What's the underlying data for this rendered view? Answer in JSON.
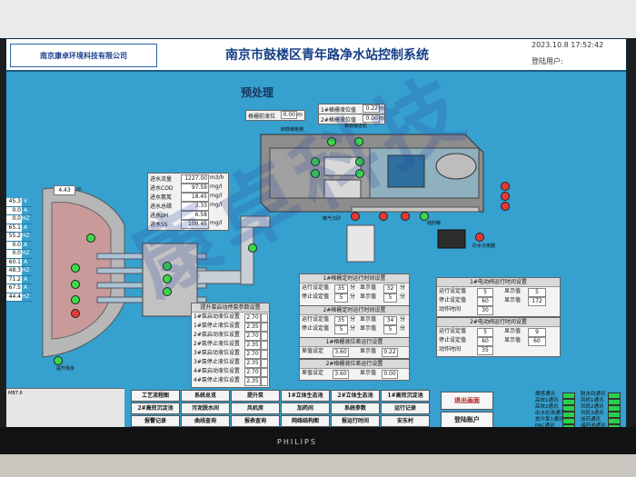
{
  "header": {
    "logo": "南京康卓环境科技有限公司",
    "title": "南京市鼓楼区青年路净水站控制系统",
    "datetime": "2023.10.8    17:52:42",
    "login_label": "登陆用户:"
  },
  "page": {
    "subtitle": "预处理"
  },
  "level_gauges": {
    "grid1_label": "1#格栅液位值",
    "grid1_value": "0.22",
    "grid1_unit": "m",
    "grid2_label": "2#格栅液位值",
    "grid2_value": "0.00",
    "grid2_unit": "m",
    "tank_label": "格栅前液位",
    "tank_value": "0.00",
    "tank_unit": "m"
  },
  "equipment_labels": {
    "screen": "转鼓细格栅",
    "sand": "螺旋输送机",
    "pump_house": "提升泵房",
    "aeration": "曝气沉砂",
    "sand_pump": "砂水分离器",
    "dosing": "储药罐",
    "flow_label": "4.43",
    "flow_unit": "m"
  },
  "influent": {
    "rows": [
      {
        "label": "进水流量",
        "value": "1227.00",
        "unit": "m3/h"
      },
      {
        "label": "进水COD",
        "value": "97.59",
        "unit": "mg/l"
      },
      {
        "label": "进水氨氮",
        "value": "18.45",
        "unit": "mg/l"
      },
      {
        "label": "进水总磷",
        "value": "3.33",
        "unit": "mg/l"
      },
      {
        "label": "进水pH",
        "value": "6.58",
        "unit": ""
      },
      {
        "label": "进水SS",
        "value": "100.45",
        "unit": "mg/l"
      }
    ]
  },
  "left_column": [
    {
      "value": "45.3",
      "unit": "V"
    },
    {
      "value": "0.0",
      "unit": "A"
    },
    {
      "value": "0.0",
      "unit": "HZ"
    },
    {
      "value": "65.1",
      "unit": "A"
    },
    {
      "value": "55.2",
      "unit": "HZ"
    },
    {
      "value": "0.0",
      "unit": "A"
    },
    {
      "value": "0.0",
      "unit": "HZ"
    },
    {
      "value": "60.1",
      "unit": "A"
    },
    {
      "value": "48.3",
      "unit": "HZ"
    },
    {
      "value": "71.2",
      "unit": "A"
    },
    {
      "value": "67.5",
      "unit": "A"
    },
    {
      "value": "44.4",
      "unit": "HZ"
    }
  ],
  "pump_setpoints": {
    "title": "提升泵启动停泵参数设置",
    "rows": [
      {
        "label": "1#泵启动液位设置",
        "value": "2.70"
      },
      {
        "label": "1#泵停止液位设置",
        "value": "2.35"
      },
      {
        "label": "2#泵启动液位设置",
        "value": "2.70"
      },
      {
        "label": "2#泵停止液位设置",
        "value": "2.35"
      },
      {
        "label": "3#泵启动液位设置",
        "value": "2.70"
      },
      {
        "label": "3#泵停止液位设置",
        "value": "2.35"
      },
      {
        "label": "4#泵启动液位设置",
        "value": "2.70"
      },
      {
        "label": "4#泵停止液位设置",
        "value": "2.35"
      }
    ]
  },
  "grid1_timer": {
    "title": "1#格栅定时运行时间设置",
    "rows": [
      {
        "label": "运行设定值",
        "set": "35",
        "u1": "分",
        "show_label": "显示值",
        "show": "32",
        "u2": "分"
      },
      {
        "label": "停止设定值",
        "set": "5",
        "u1": "分",
        "show_label": "显示值",
        "show": "5",
        "u2": "分"
      }
    ]
  },
  "grid2_timer": {
    "title": "2#格栅定时运行时间设置",
    "rows": [
      {
        "label": "运行设定值",
        "set": "35",
        "u1": "分",
        "show_label": "显示值",
        "show": "34",
        "u2": "分"
      },
      {
        "label": "停止设定值",
        "set": "5",
        "u1": "分",
        "show_label": "显示值",
        "show": "5",
        "u2": "分"
      }
    ]
  },
  "grid1_diff": {
    "title": "1#格栅液位差运行设置",
    "label": "差值设定",
    "value": "3.60",
    "mid": "显示值",
    "show": "0.22"
  },
  "grid2_diff": {
    "title": "2#格栅液位差运行设置",
    "label": "差值设定",
    "value": "3.60",
    "mid": "显示值",
    "show": "0.00"
  },
  "valve1": {
    "title": "1#电动阀运行时间设置",
    "rows": [
      {
        "label": "运行设定值",
        "set": "5",
        "show_label": "显示值",
        "show": "5"
      },
      {
        "label": "停止设定值",
        "set": "60",
        "show_label": "显示值",
        "show": "172"
      },
      {
        "label": "动作时间",
        "set": "30",
        "show_label": "",
        "show": ""
      }
    ]
  },
  "valve2": {
    "title": "2#电动阀运行时间设置",
    "rows": [
      {
        "label": "运行设定值",
        "set": "5",
        "show_label": "显示值",
        "show": "9"
      },
      {
        "label": "停止设定值",
        "set": "60",
        "show_label": "显示值",
        "show": "60"
      },
      {
        "label": "动作时间",
        "set": "35",
        "show_label": "",
        "show": ""
      }
    ]
  },
  "nav": {
    "row1": [
      "工艺流程图",
      "系统总览",
      "提升泵",
      "1#立体生态池",
      "2#立体生态池",
      "1#高效沉淀池"
    ],
    "row2": [
      "2#高效沉淀池",
      "污泥脱水间",
      "风机房",
      "加药间",
      "系统参数",
      "运行记录"
    ],
    "row3": [
      "报警记录",
      "曲线查询",
      "报表查询",
      "网络结构图",
      "报运行时间",
      "安东村"
    ],
    "exit": "退出画面",
    "account": "登陆账户"
  },
  "status_list": [
    "拥塔通讯",
    "高效1通讯",
    "高效2通讯",
    "出水检测通讯",
    "提升泵1通讯",
    "PAC通讯",
    "PAM通讯",
    "脱水间通讯",
    "风机1通讯",
    "风机2通讯",
    "风机3通讯",
    "加药通讯",
    "储药池通讯",
    "设备间通讯"
  ],
  "bottom_left": {
    "label": "MB7.6"
  },
  "screen_brand": "PHILIPS"
}
